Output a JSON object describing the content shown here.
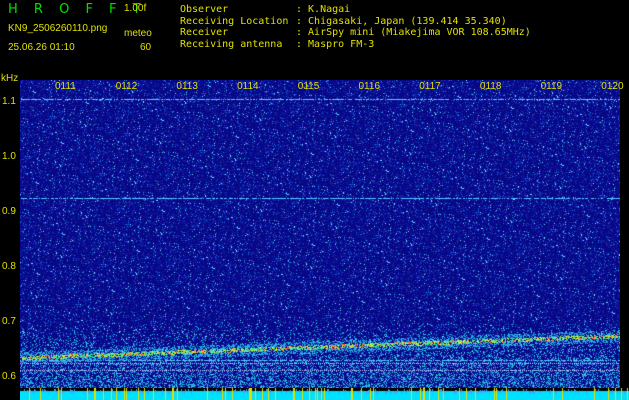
{
  "header": {
    "logo": "H R O F F T",
    "version": "1.00f",
    "filename": "KN9_2506260110.png",
    "timestamp": "25.06.26 01:10",
    "meteo_label": "meteo",
    "meteo_value": "60",
    "info": [
      {
        "key": "Observer",
        "value": ": K.Nagai"
      },
      {
        "key": "Receiving Location",
        "value": ": Chigasaki, Japan (139.414 35.340)"
      },
      {
        "key": "Receiver",
        "value": ": AirSpy mini (Miakejima VOR 108.65MHz)"
      },
      {
        "key": "Receiving antenna",
        "value": ": Maspro FM-3"
      }
    ]
  },
  "axis": {
    "unit": "kHz",
    "y_ticks": [
      "1.1",
      "1.0",
      "0.9",
      "0.8",
      "0.7",
      "0.6"
    ],
    "y_values": [
      1.1,
      1.0,
      0.9,
      0.8,
      0.7,
      0.6
    ],
    "ylim": [
      0.58,
      1.14
    ],
    "time_labels": [
      "0111",
      "0112",
      "0113",
      "0114",
      "0115",
      "0116",
      "0117",
      "0118",
      "0119",
      "0120"
    ]
  },
  "spectrogram": {
    "carrier_lines_khz": [
      1.105,
      0.925,
      0.63
    ],
    "drift_start_khz": 0.635,
    "drift_end_khz": 0.675
  },
  "colors": {
    "background": "#0a0a8c",
    "label": "#e0e000",
    "logo": "#00e000",
    "bottom_bar": "#00e0ff"
  }
}
